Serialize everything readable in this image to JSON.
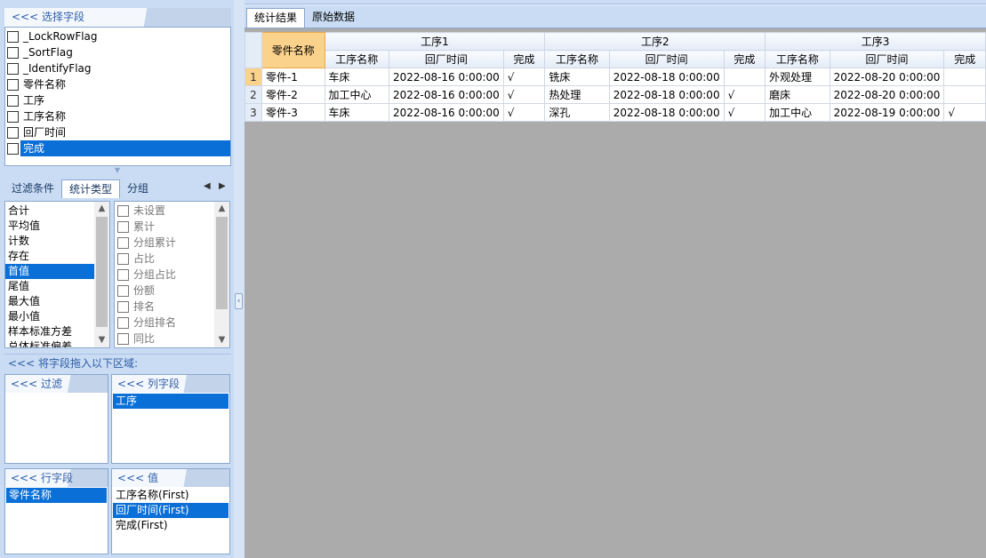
{
  "left": {
    "field_panel": {
      "title": "<<< 选择字段",
      "fields": [
        "_LockRowFlag",
        "_SortFlag",
        "_IdentifyFlag",
        "零件名称",
        "工序",
        "工序名称",
        "回厂时间",
        "完成"
      ],
      "selected_index": 7
    },
    "tabs": [
      "过滤条件",
      "统计类型",
      "分组"
    ],
    "active_tab": 1,
    "stat_types": [
      "合计",
      "平均值",
      "计数",
      "存在",
      "首值",
      "尾值",
      "最大值",
      "最小值",
      "样本标准方差",
      "总体标准偏差"
    ],
    "selected_stat_index": 4,
    "stat_options": [
      "未设置",
      "累计",
      "分组累计",
      "占比",
      "分组占比",
      "份额",
      "排名",
      "分组排名",
      "同比"
    ],
    "drag_title": "<<< 将字段拖入以下区域:",
    "filter_area": {
      "title": "<<< 过滤",
      "items": []
    },
    "column_area": {
      "title": "<<< 列字段",
      "items": [
        "工序"
      ]
    },
    "row_area": {
      "title": "<<< 行字段",
      "items": [
        "零件名称"
      ]
    },
    "value_area": {
      "title": "<<< 值",
      "items": [
        "工序名称(First)",
        "回厂时间(First)",
        "完成(First)"
      ],
      "selected_index": 1
    }
  },
  "right": {
    "tabs": [
      "统计结果",
      "原始数据"
    ],
    "active_tab": 0,
    "grid": {
      "row_header_title": "零件名称",
      "groups": [
        "工序1",
        "工序2",
        "工序3"
      ],
      "sub_columns": [
        "工序名称",
        "回厂时间",
        "完成"
      ],
      "rows": [
        {
          "num": "1",
          "label": "零件-1",
          "cells": [
            "车床",
            "2022-08-16 0:00:00",
            "√",
            "铣床",
            "2022-08-18 0:00:00",
            "",
            "外观处理",
            "2022-08-20 0:00:00",
            ""
          ]
        },
        {
          "num": "2",
          "label": "零件-2",
          "cells": [
            "加工中心",
            "2022-08-16 0:00:00",
            "√",
            "热处理",
            "2022-08-18 0:00:00",
            "√",
            "磨床",
            "2022-08-20 0:00:00",
            ""
          ]
        },
        {
          "num": "3",
          "label": "零件-3",
          "cells": [
            "车床",
            "2022-08-16 0:00:00",
            "√",
            "深孔",
            "2022-08-18 0:00:00",
            "√",
            "加工中心",
            "2022-08-19 0:00:00",
            "√"
          ]
        }
      ]
    }
  }
}
